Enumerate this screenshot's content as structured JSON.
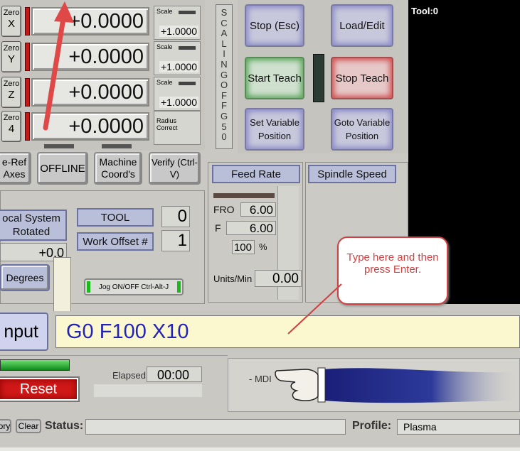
{
  "dro": {
    "rows": [
      {
        "zero_label": "Zero",
        "axis": "X",
        "value": "+0.0000",
        "scale_label": "Scale",
        "scale_value": "+1.0000"
      },
      {
        "zero_label": "Zero",
        "axis": "Y",
        "value": "+0.0000",
        "scale_label": "Scale",
        "scale_value": "+1.0000"
      },
      {
        "zero_label": "Zero",
        "axis": "Z",
        "value": "+0.0000",
        "scale_label": "Scale",
        "scale_value": "+1.0000"
      },
      {
        "zero_label": "Zero",
        "axis": "4",
        "value": "+0.0000",
        "scale_label": "Radius Correct"
      }
    ]
  },
  "scaling": {
    "text": "SCALING OFF G50"
  },
  "buttons": {
    "stop": "Stop (Esc)",
    "load_edit": "Load/Edit",
    "start_teach": "Start Teach",
    "stop_teach": "Stop Teach",
    "set_variable": "Set Variable Position",
    "goto_variable": "Goto Variable Position",
    "reref": "e-Ref Axes",
    "offline": "OFFLINE",
    "machine_coords": "Machine Coord's",
    "verify": "Verify (Ctrl-V)",
    "degrees": "Degrees",
    "jog": "Jog ON/OFF Ctrl-Alt-J",
    "reset": "Reset",
    "history": "ory",
    "clear": "Clear"
  },
  "toolview": {
    "label": "Tool:0"
  },
  "feed": {
    "title": "Feed Rate",
    "fro_label": "FRO",
    "fro_value": "6.00",
    "f_label": "F",
    "f_value": "6.00",
    "percent_value": "100",
    "percent_sign": "%",
    "units_label": "Units/Min",
    "units_value": "0.00"
  },
  "spindle": {
    "title": "Spindle Speed"
  },
  "offsets": {
    "local_system": "ocal System Rotated",
    "rotation_value": "+0.0",
    "tool_label": "TOOL",
    "tool_value": "0",
    "work_offset_label": "Work Offset #",
    "work_offset_value": "1"
  },
  "callout": {
    "text": "Type here and then press Enter."
  },
  "mdi": {
    "label": "nput",
    "value": "G0 F100 X10",
    "mode": "- MDI"
  },
  "elapsed": {
    "label": "Elapsed",
    "value": "00:00"
  },
  "status": {
    "label": "Status:",
    "value": "",
    "profile_label": "Profile:",
    "profile_value": "Plasma"
  },
  "colors": {
    "arrow": "#e04848",
    "reset": "#d01818",
    "accent": "#6b71a0"
  }
}
